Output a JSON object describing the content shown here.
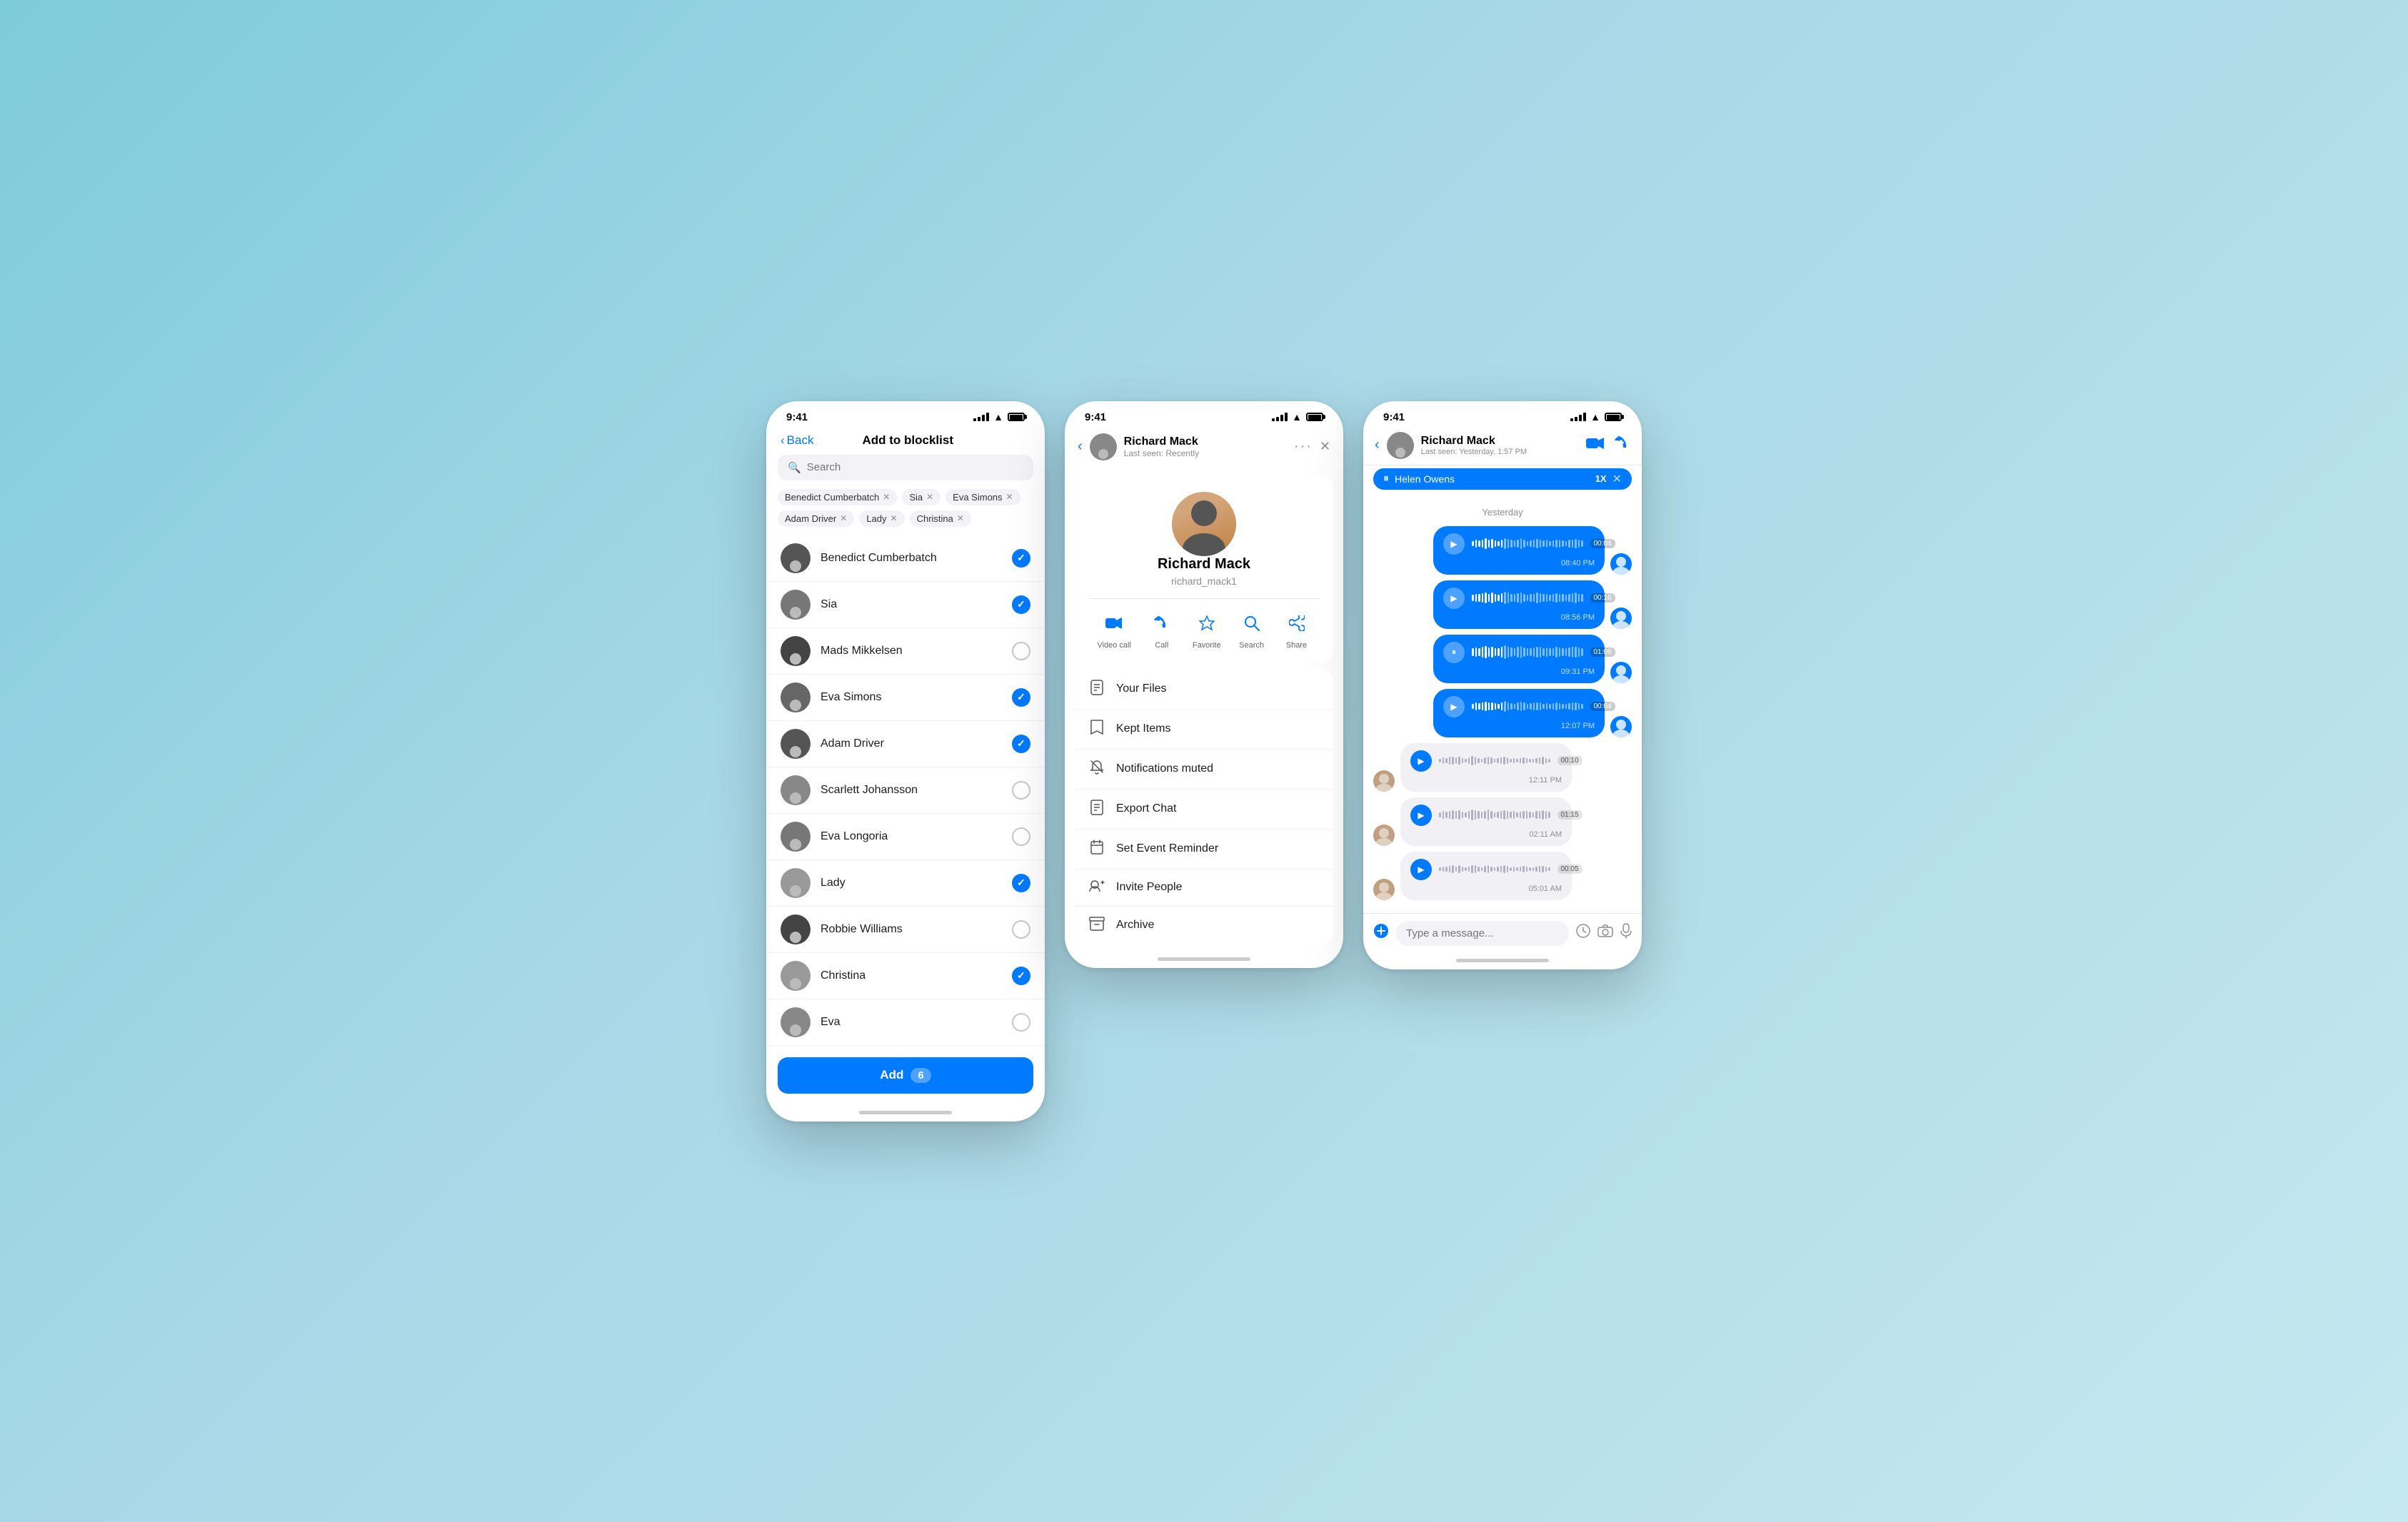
{
  "statusBar": {
    "time": "9:41"
  },
  "phone1": {
    "title": "Add to blocklist",
    "backLabel": "Back",
    "search": {
      "placeholder": "Search"
    },
    "tags": [
      {
        "label": "Benedict Cumberbatch"
      },
      {
        "label": "Sia"
      },
      {
        "label": "Eva Simons"
      },
      {
        "label": "Adam Driver"
      },
      {
        "label": "Lady"
      },
      {
        "label": "Christina"
      }
    ],
    "contacts": [
      {
        "name": "Benedict Cumberbatch",
        "checked": true
      },
      {
        "name": "Sia",
        "checked": true
      },
      {
        "name": "Mads Mikkelsen",
        "checked": false
      },
      {
        "name": "Eva Simons",
        "checked": true
      },
      {
        "name": "Adam Driver",
        "checked": true
      },
      {
        "name": "Scarlett Johansson",
        "checked": false
      },
      {
        "name": "Eva Longoria",
        "checked": false
      },
      {
        "name": "Lady",
        "checked": true
      },
      {
        "name": "Robbie Williams",
        "checked": false
      },
      {
        "name": "Christina",
        "checked": true
      },
      {
        "name": "Eva",
        "checked": false
      }
    ],
    "addButton": {
      "label": "Add",
      "count": "6"
    }
  },
  "phone2": {
    "name": "Richard Mack",
    "username": "richard_mack1",
    "lastSeen": "Last seen: Recently",
    "actions": [
      {
        "label": "Video call",
        "icon": "📹"
      },
      {
        "label": "Call",
        "icon": "📞"
      },
      {
        "label": "Favorite",
        "icon": "☆"
      },
      {
        "label": "Search",
        "icon": "🔍"
      },
      {
        "label": "Share",
        "icon": "↗"
      }
    ],
    "menuItems": [
      {
        "label": "Your Files",
        "icon": "📄"
      },
      {
        "label": "Kept Items",
        "icon": "🔖"
      },
      {
        "label": "Notifications muted",
        "icon": "🔕"
      },
      {
        "label": "Export Chat",
        "icon": "📅"
      },
      {
        "label": "Set Event Reminder",
        "icon": "📆"
      },
      {
        "label": "Invite People",
        "icon": "👤"
      },
      {
        "label": "Archive",
        "icon": "📥"
      }
    ],
    "dots": "···"
  },
  "phone3": {
    "name": "Richard Mack",
    "lastSeen": "Last seen: Yesterday, 1:57 PM",
    "callPill": {
      "name": "Helen Owens",
      "speed": "1X"
    },
    "dateDivider": "Yesterday",
    "messages": [
      {
        "type": "sent",
        "duration": "00:04",
        "time": "08:40 PM",
        "bars": [
          3,
          5,
          4,
          6,
          8,
          5,
          7,
          4,
          3,
          6,
          9,
          7,
          5,
          4,
          6,
          8,
          5,
          3,
          4,
          5,
          7,
          6,
          4,
          5,
          3,
          4,
          6,
          5,
          4,
          3,
          5,
          6,
          7,
          5,
          4
        ]
      },
      {
        "type": "sent",
        "duration": "00:16",
        "time": "08:56 PM",
        "bars": [
          4,
          6,
          5,
          7,
          9,
          6,
          8,
          5,
          4,
          7,
          10,
          8,
          6,
          5,
          7,
          9,
          6,
          4,
          5,
          6,
          8,
          7,
          5,
          6,
          4,
          5,
          7,
          6,
          5,
          4,
          6,
          7,
          8,
          6,
          5
        ]
      },
      {
        "type": "sent",
        "duration": "01:06",
        "time": "09:31 PM",
        "bars": [
          5,
          7,
          6,
          8,
          10,
          7,
          9,
          6,
          5,
          8,
          11,
          9,
          7,
          6,
          8,
          10,
          7,
          5,
          6,
          7,
          9,
          8,
          6,
          7,
          5,
          6,
          8,
          7,
          6,
          5,
          7,
          8,
          9,
          7,
          6
        ],
        "paused": true
      },
      {
        "type": "sent",
        "duration": "00:04",
        "time": "12:07 PM",
        "bars": [
          3,
          5,
          4,
          6,
          7,
          5,
          6,
          4,
          3,
          5,
          8,
          6,
          4,
          3,
          5,
          7,
          5,
          3,
          4,
          5,
          6,
          5,
          3,
          4,
          3,
          4,
          5,
          4,
          3,
          3,
          4,
          5,
          6,
          4,
          3
        ]
      },
      {
        "type": "received",
        "duration": "00:10",
        "time": "12:11 PM",
        "bars": [
          2,
          4,
          3,
          5,
          6,
          4,
          5,
          3,
          2,
          4,
          7,
          5,
          3,
          2,
          4,
          6,
          4,
          2,
          3,
          4,
          5,
          4,
          2,
          3,
          2,
          3,
          4,
          3,
          2,
          2,
          3,
          4,
          5,
          3,
          2
        ]
      },
      {
        "type": "received",
        "duration": "01:15",
        "time": "02:11 AM",
        "bars": [
          3,
          5,
          4,
          6,
          7,
          5,
          7,
          4,
          3,
          5,
          8,
          7,
          5,
          4,
          6,
          8,
          5,
          3,
          4,
          5,
          7,
          6,
          4,
          5,
          3,
          4,
          6,
          5,
          4,
          3,
          5,
          6,
          7,
          5,
          4
        ]
      },
      {
        "type": "received",
        "duration": "00:05",
        "time": "05:01 AM",
        "bars": [
          2,
          3,
          3,
          4,
          5,
          3,
          5,
          3,
          2,
          3,
          6,
          5,
          3,
          2,
          4,
          5,
          3,
          2,
          3,
          4,
          5,
          4,
          2,
          3,
          2,
          3,
          4,
          3,
          2,
          2,
          3,
          4,
          4,
          3,
          2
        ]
      }
    ],
    "inputPlaceholder": "Type a message..."
  }
}
